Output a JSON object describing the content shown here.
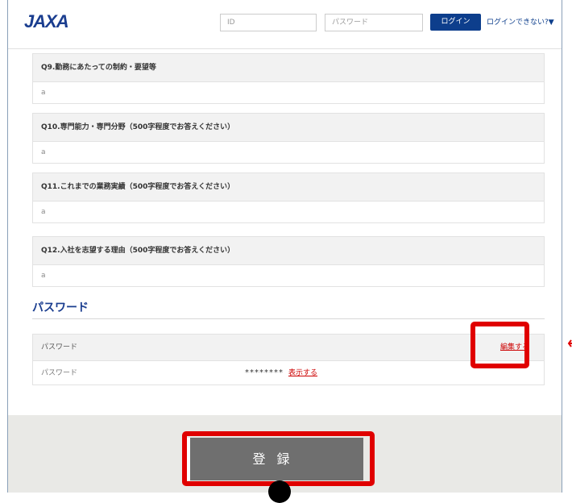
{
  "header": {
    "logo": "JAXA",
    "id_placeholder": "ID",
    "password_placeholder": "パスワード",
    "login_button": "ログイン",
    "cant_login": "ログインできない?▼"
  },
  "questions": [
    {
      "label": "Q9.勤務にあたっての制約・要望等",
      "answer": "a"
    },
    {
      "label": "Q10.専門能力・専門分野（500字程度でお答えください）",
      "answer": "a"
    },
    {
      "label": "Q11.これまでの業務実績（500字程度でお答えください）",
      "answer": "a"
    },
    {
      "label": "Q12.入社を志望する理由（500字程度でお答えください）",
      "answer": "a"
    }
  ],
  "password_section": {
    "title": "パスワード",
    "header_label": "パスワード",
    "edit_link": "編集する",
    "row_label": "パスワード",
    "masked_value": "********",
    "show_link": "表示する"
  },
  "footer": {
    "submit_button": "登録"
  },
  "colors": {
    "brand": "#0d3e8c",
    "annotation": "#e00000",
    "link": "#cc0000"
  }
}
